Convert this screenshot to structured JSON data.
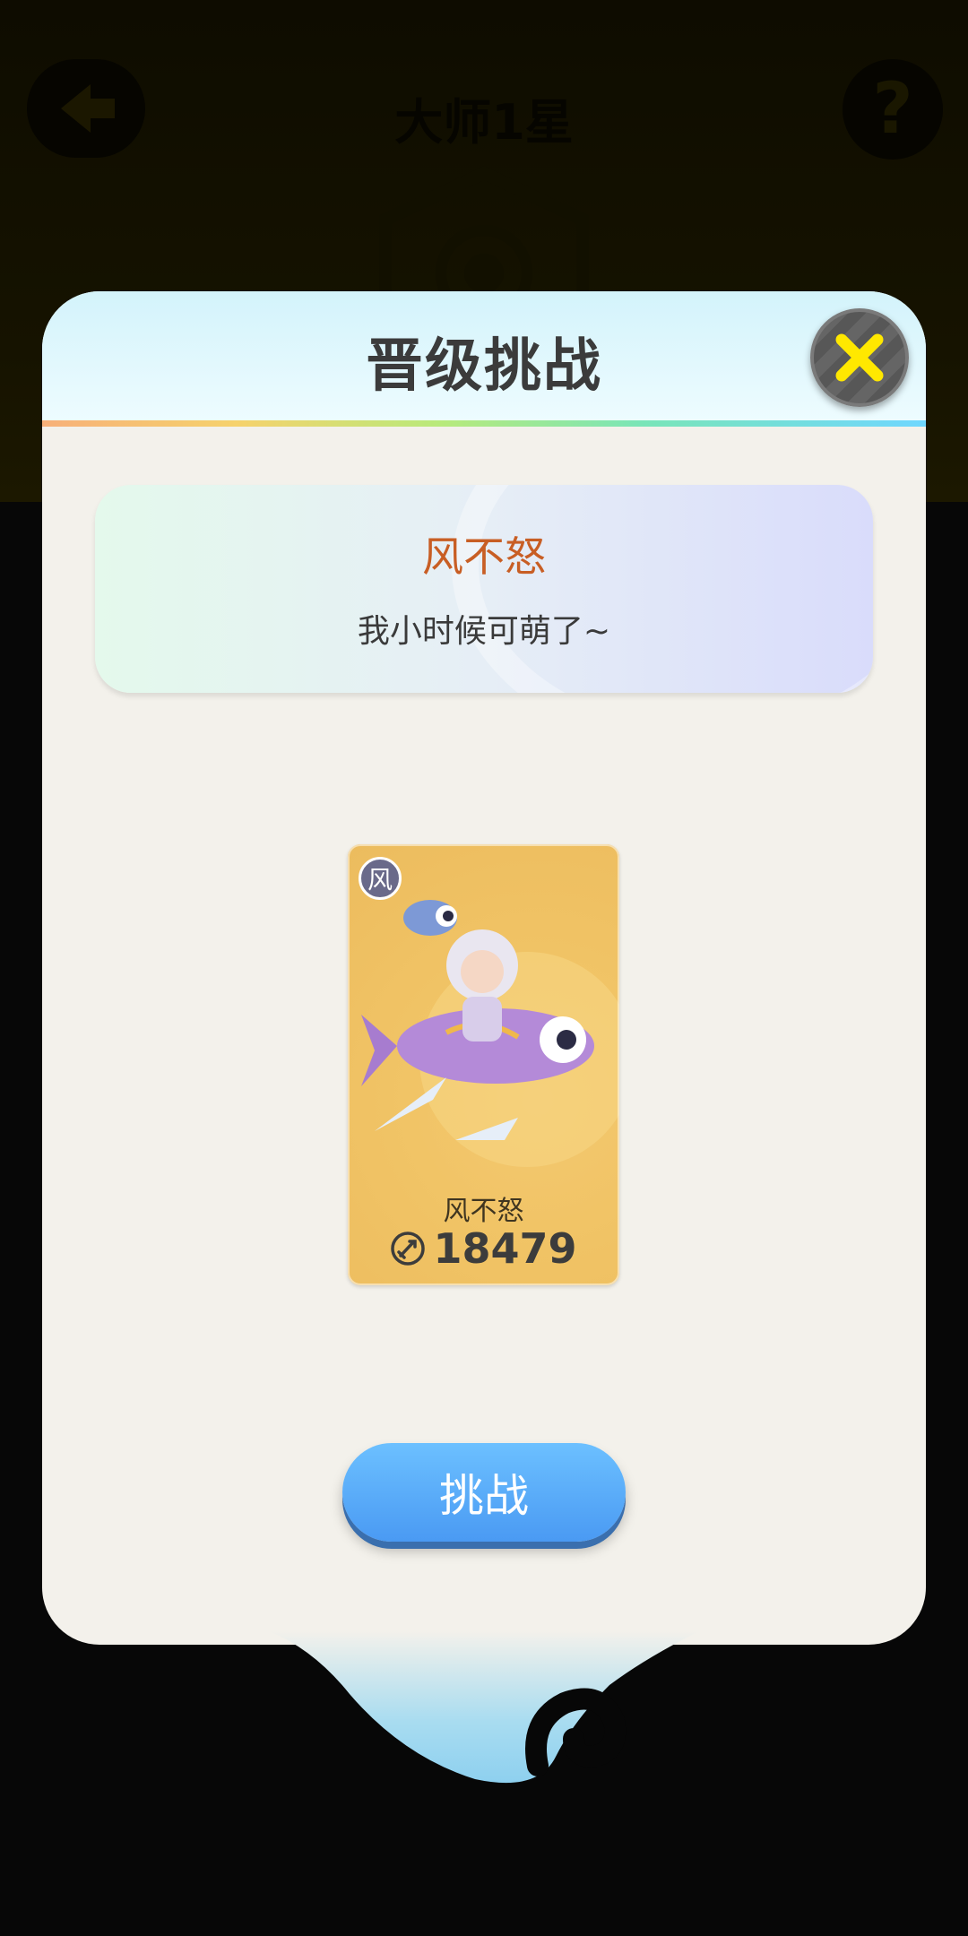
{
  "background": {
    "rank_title": "大师1星",
    "help_glyph": "?"
  },
  "dialog": {
    "title": "晋级挑战",
    "quote": {
      "name": "风不怒",
      "text": "我小时候可萌了~"
    },
    "hero": {
      "element_badge": "风",
      "name": "风不怒",
      "power": "18479"
    },
    "challenge_label": "挑战"
  },
  "colors": {
    "title": "#3b3b3b",
    "quote_name": "#c85e24",
    "button_blue": "#4a9af3",
    "close_x": "#ffe800"
  }
}
